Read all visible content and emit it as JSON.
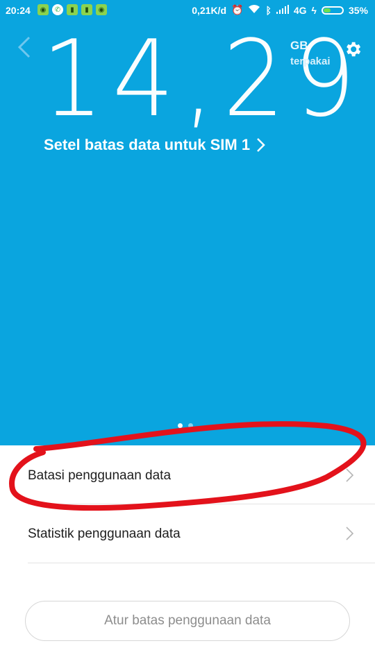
{
  "status_bar": {
    "time": "20:24",
    "network_speed": "0,21K/d",
    "network_type": "4G",
    "battery": "35%",
    "battery_level": 0.35,
    "notification_icons": [
      "android-notify-icon",
      "whatsapp-icon",
      "sim-card-icon",
      "sim-card-icon",
      "android-notify-icon"
    ],
    "right_icons": [
      "alarm-icon",
      "wifi-icon",
      "bluetooth-icon",
      "signal-icon",
      "charging-icon"
    ]
  },
  "hero": {
    "data_used": "14,29",
    "unit": "GB",
    "unit_caption": "terpakai",
    "set_limit_link": "Setel batas data untuk SIM 1",
    "page_count": 2,
    "active_page": 0
  },
  "menu": {
    "items": [
      {
        "label": "Batasi penggunaan data"
      },
      {
        "label": "Statistik penggunaan data"
      }
    ]
  },
  "action": {
    "button_label": "Atur batas penggunaan data"
  },
  "colors": {
    "hero_background": "#0aa5df",
    "annotation_stroke": "#e3121b",
    "battery_fill": "#6ee04f"
  }
}
